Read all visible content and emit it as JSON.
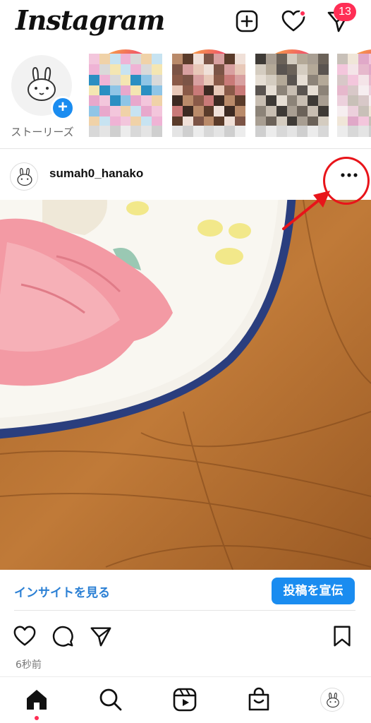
{
  "header": {
    "logo": "Instagram",
    "dm_badge_count": "13",
    "icons": [
      "add-post-icon",
      "heart-icon",
      "direct-message-icon"
    ]
  },
  "stories": {
    "own_label": "ストーリーズ",
    "own_add_icon": "+"
  },
  "post": {
    "username": "sumah0_hanako",
    "more_icon": "ellipsis-icon",
    "insight_link": "インサイトを見る",
    "promote_button": "投稿を宣伝",
    "timestamp": "6秒前",
    "actions": [
      "like-icon",
      "comment-icon",
      "share-icon",
      "save-icon"
    ]
  },
  "bottom_nav": {
    "items": [
      "home-icon",
      "search-icon",
      "reels-icon",
      "shop-icon",
      "profile-avatar"
    ]
  },
  "colors": {
    "accent": "#1a8cf0",
    "badge": "#ff2e55",
    "link": "#2a7fd4",
    "annotation": "#e8141a"
  }
}
